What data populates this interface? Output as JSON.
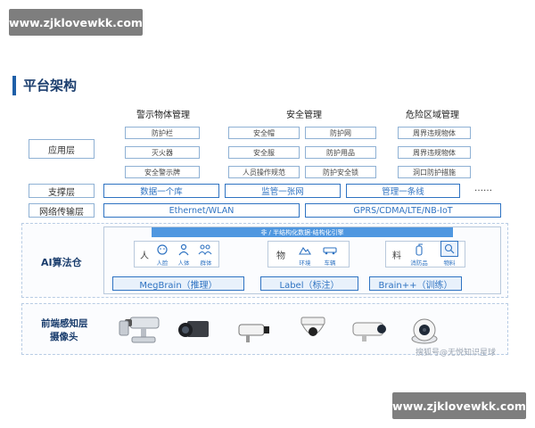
{
  "watermark": {
    "top": "www.zjklovewkk.com",
    "bottom": "www.zjklovewkk.com"
  },
  "title": "平台架构",
  "columns": [
    "警示物体管理",
    "安全管理",
    "危险区域管理"
  ],
  "layers": {
    "application": "应用层",
    "support": "支撑层",
    "network": "网络传输层",
    "ai": "AI算法仓",
    "front_line1": "前端感知层",
    "front_line2": "摄像头"
  },
  "app_cells": {
    "col1": [
      "防护栏",
      "灭火器",
      "安全警示牌"
    ],
    "col2a": [
      "安全帽",
      "安全服",
      "人员操作规范"
    ],
    "col2b": [
      "防护网",
      "防护用品",
      "防护安全锁"
    ],
    "col3": [
      "周界违规物体",
      "周界违规物体",
      "洞口防护措施"
    ]
  },
  "support_cells": [
    "数据一个库",
    "监管一张网",
    "管理一条线",
    "……"
  ],
  "network_cells": [
    "Ethernet/WLAN",
    "GPRS/CDMA/LTE/NB-IoT"
  ],
  "ai": {
    "banner": "非 / 半结构化数据-结构化引擎",
    "groups": [
      {
        "char": "人",
        "items": [
          {
            "icon": "face-icon",
            "label": "人脸"
          },
          {
            "icon": "body-icon",
            "label": "人体"
          },
          {
            "icon": "crowd-icon",
            "label": "群体"
          }
        ]
      },
      {
        "char": "物",
        "items": [
          {
            "icon": "environment-icon",
            "label": "环境"
          },
          {
            "icon": "vehicle-icon",
            "label": "车辆"
          }
        ]
      },
      {
        "char": "料",
        "items": [
          {
            "icon": "fire-equipment-icon",
            "label": "消防品"
          },
          {
            "icon": "material-icon",
            "label": "物料"
          }
        ]
      }
    ],
    "brains": [
      "MegBrain（推理）",
      "Label（标注）",
      "Brain++（训练）"
    ]
  },
  "cameras": [
    "ptz-camera-icon",
    "box-camera-icon",
    "bullet-camera-small-icon",
    "dome-camera-icon",
    "bullet-camera-icon",
    "turret-camera-icon"
  ],
  "credit": "搜狐号@无悦知识星球",
  "colors": {
    "accent": "#2f73c2",
    "title": "#1a3d6d",
    "banner": "#4f97e0",
    "watermark_bg": "#7e7e7e"
  }
}
